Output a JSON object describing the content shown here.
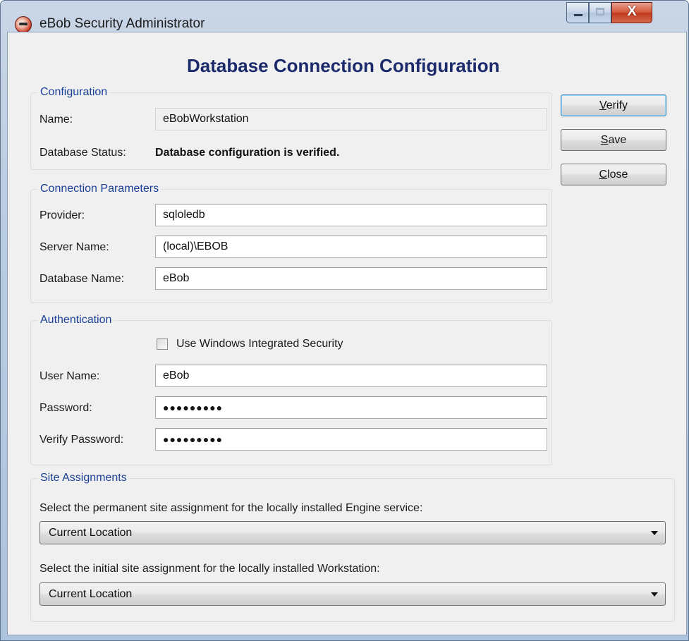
{
  "window": {
    "title": "eBob Security Administrator",
    "controls": {
      "minimize": "minimize",
      "maximize": "maximize",
      "close": "X"
    }
  },
  "heading": "Database Connection Configuration",
  "configuration": {
    "group_title": "Configuration",
    "name_label": "Name:",
    "name_value": "eBobWorkstation",
    "status_label": "Database Status:",
    "status_value": "Database configuration is verified."
  },
  "connection": {
    "group_title": "Connection Parameters",
    "provider_label": "Provider:",
    "provider_value": "sqloledb",
    "server_label": "Server Name:",
    "server_value": "(local)\\EBOB",
    "database_label": "Database Name:",
    "database_value": "eBob"
  },
  "authentication": {
    "group_title": "Authentication",
    "windows_security_label": "Use Windows Integrated Security",
    "windows_security_checked": false,
    "username_label": "User Name:",
    "username_value": "eBob",
    "password_label": "Password:",
    "password_value": "●●●●●●●●●",
    "verify_password_label": "Verify Password:",
    "verify_password_value": "●●●●●●●●●"
  },
  "sites": {
    "group_title": "Site Assignments",
    "engine_prompt": "Select the permanent site assignment for the locally installed Engine service:",
    "engine_selected": "Current Location",
    "workstation_prompt": "Select the initial site assignment for the locally installed Workstation:",
    "workstation_selected": "Current Location"
  },
  "buttons": {
    "verify_mnemonic": "V",
    "verify_rest": "erify",
    "save_mnemonic": "S",
    "save_rest": "ave",
    "close_mnemonic": "C",
    "close_rest": "lose"
  },
  "colors": {
    "heading": "#1b2a6b",
    "group_title": "#1a3f97",
    "title_bar": "#b9cbe0"
  },
  "icons": {
    "app": "ebob-app-icon",
    "dropdown": "chevron-down-icon"
  }
}
